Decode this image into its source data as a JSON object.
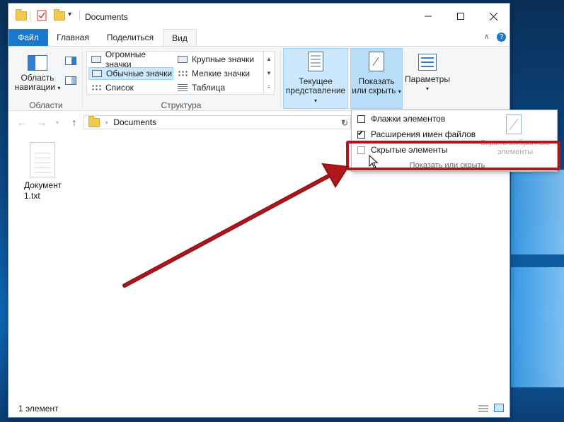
{
  "window": {
    "title": "Documents",
    "tabs": {
      "file": "Файл",
      "home": "Главная",
      "share": "Поделиться",
      "view": "Вид"
    }
  },
  "ribbon": {
    "nav_pane": {
      "label_line1": "Область",
      "label_line2": "навигации"
    },
    "group_panes": "Области",
    "layout": {
      "items": [
        "Огромные значки",
        "Крупные значки",
        "Обычные значки",
        "Мелкие значки",
        "Список",
        "Таблица"
      ],
      "selected": "Обычные значки"
    },
    "group_layout": "Структура",
    "current_view": {
      "label_line1": "Текущее",
      "label_line2": "представление"
    },
    "show_hide": {
      "label_line1": "Показать",
      "label_line2": "или скрыть"
    },
    "options": {
      "label": "Параметры"
    }
  },
  "address": {
    "path": "Documents"
  },
  "files": [
    {
      "name": "Документ 1.txt"
    }
  ],
  "status": {
    "count": "1 элемент"
  },
  "show_hide_menu": {
    "item_checkboxes": {
      "label": "Флажки элементов",
      "checked": false
    },
    "file_extensions": {
      "label": "Расширения имен файлов",
      "checked": true
    },
    "hidden_items": {
      "label": "Скрытые элементы",
      "checked": false
    },
    "hide_selected": {
      "label_line1": "Скрыть выбранные",
      "label_line2": "элементы"
    },
    "group_label": "Показать или скрыть"
  },
  "colors": {
    "accent": "#1979ca",
    "annotation": "#b0171b"
  }
}
